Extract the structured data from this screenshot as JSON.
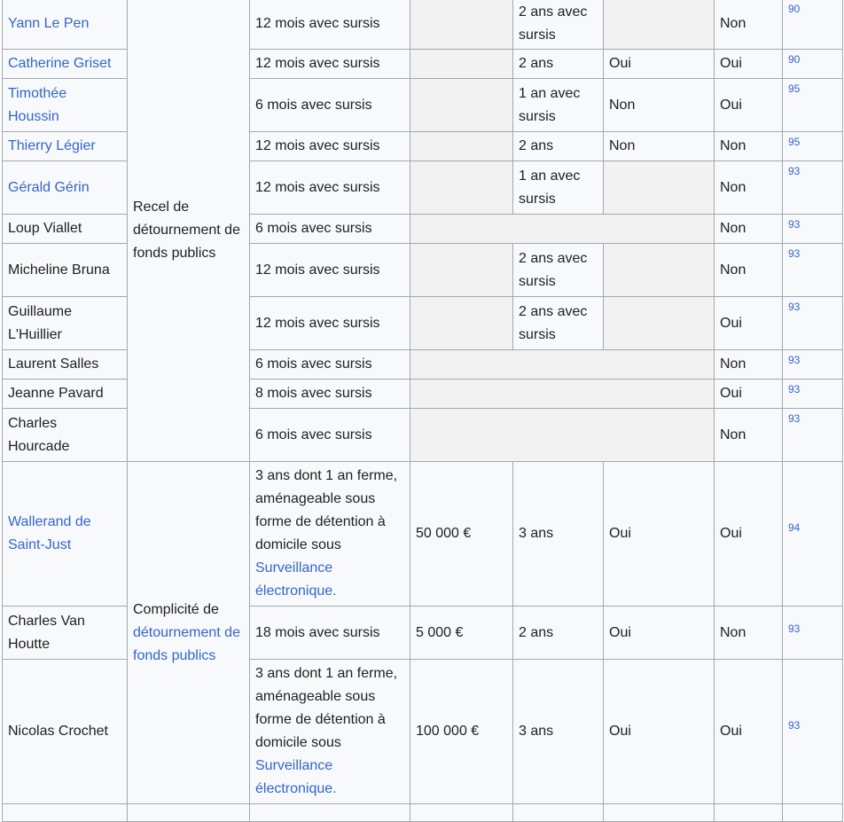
{
  "rows": [
    {
      "name": "Yann Le Pen",
      "name_link": true,
      "sentence": "12 mois avec sursis",
      "ineligibility": "2 ans avec sursis",
      "ref": "90"
    },
    {
      "name": "Catherine Griset",
      "name_link": true,
      "sentence": "12 mois avec sursis",
      "ineligibility": "2 ans",
      "provisional": "Oui",
      "appeal": "Oui",
      "ref": "90"
    },
    {
      "name": "Timothée Houssin",
      "name_link": true,
      "sentence": "6 mois avec sursis",
      "ineligibility": "1 an avec sursis",
      "provisional": "Non",
      "appeal": "Oui",
      "ref": "95"
    },
    {
      "name": "Thierry Légier",
      "name_link": true,
      "sentence": "12 mois avec sursis",
      "ineligibility": "2 ans",
      "provisional": "Non",
      "appeal": "Non",
      "ref": "95"
    },
    {
      "name": "Gérald Gérin",
      "name_link": true,
      "sentence": "12 mois avec sursis",
      "ineligibility": "1 an avec sursis",
      "ref": "93"
    },
    {
      "name": "Loup Viallet",
      "sentence": "6 mois avec sursis",
      "ref": "93"
    },
    {
      "name": "Micheline Bruna",
      "sentence": "12 mois avec sursis",
      "ineligibility": "2 ans avec sursis",
      "ref": "93"
    },
    {
      "name": "Guillaume L'Huillier",
      "sentence": "12 mois avec sursis",
      "ineligibility": "2 ans avec sursis",
      "ref": "93"
    },
    {
      "name": "Laurent Salles",
      "sentence": "6 mois avec sursis",
      "ref": "93"
    },
    {
      "name": "Jeanne Pavard",
      "sentence": "8 mois avec sursis",
      "ref": "93"
    },
    {
      "name": "Charles Hourcade",
      "sentence": "6 mois avec sursis",
      "ref": "93"
    },
    {
      "name": "Wallerand de Saint-Just",
      "name_link": true,
      "sentence": "3 ans dont 1 an ferme, aménageable sous forme de détention à domicile sous",
      "sentence_link": "Surveillance électronique.",
      "fine": "50 000 €",
      "ineligibility": "3 ans",
      "provisional": "Oui",
      "appeal": "Oui",
      "ref": "94"
    },
    {
      "name": "Charles Van Houtte",
      "sentence": "18 mois avec sursis",
      "fine": "5 000 €",
      "ineligibility": "2 ans",
      "provisional": "Oui",
      "appeal": "Non",
      "ref": "93"
    },
    {
      "name": "Nicolas Crochet",
      "sentence": "3 ans dont 1 an ferme, aménageable sous forme de détention à domicile sous",
      "sentence_link": "Surveillance électronique.",
      "fine": "100 000 €",
      "ineligibility": "3 ans",
      "provisional": "Oui",
      "appeal": "Oui",
      "ref": "93"
    }
  ],
  "offense_1": "Recel de détournement de fonds publics",
  "offense_2_prefix": "Complicité de",
  "offense_2_link": "détournement de fonds publics",
  "appeal_values": {
    "row0": "Non",
    "row4": "Non",
    "row5": "Non",
    "row6": "Non",
    "row7": "Oui",
    "row8": "Non",
    "row9": "Oui",
    "row10": "Non"
  }
}
